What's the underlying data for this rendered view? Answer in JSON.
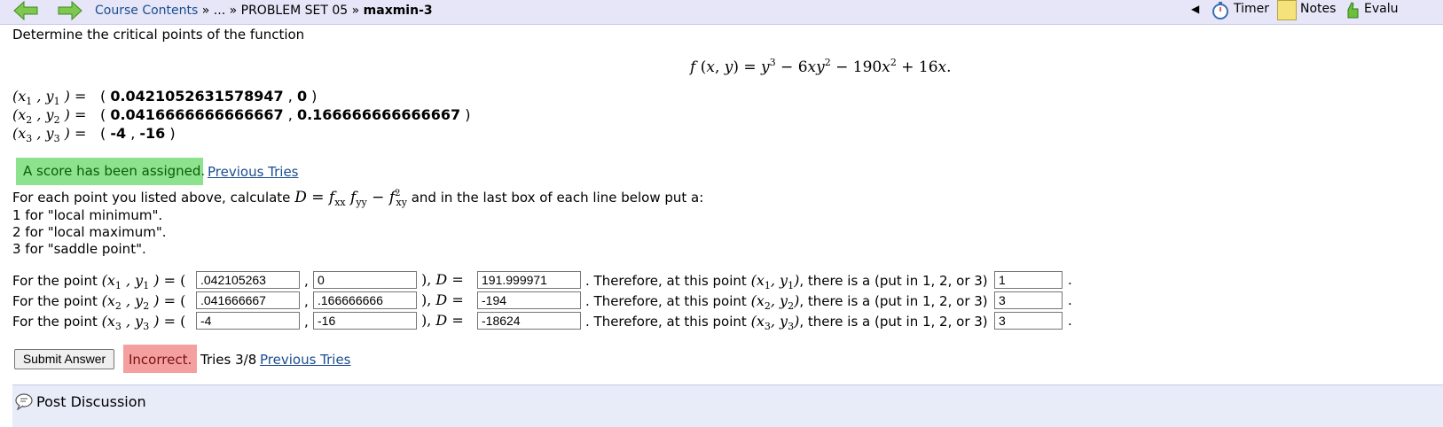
{
  "nav": {
    "crumb_course": "Course Contents",
    "crumb_sep1": "»",
    "crumb_ellipsis": "...",
    "crumb_sep2": "»",
    "crumb_set": "PROBLEM SET 05",
    "crumb_sep3": "»",
    "crumb_problem": "maxmin-3",
    "timer_label": "Timer",
    "notes_label": "Notes",
    "eval_label": "Evalu"
  },
  "problem": {
    "prompt": "Determine the critical points of the function",
    "equals": "=",
    "points": [
      {
        "x": "0.0421052631578947",
        "y": "0"
      },
      {
        "x": "0.0416666666666667",
        "y": "0.166666666666667"
      },
      {
        "x": "-4",
        "y": "-16"
      }
    ],
    "score_status": "A score has been assigned.",
    "previous_tries": "Previous Tries",
    "instr_before": "For each point you listed above, calculate",
    "instr_after": "and in the last box of each line below put a:",
    "opt1": "1 for \"local minimum\".",
    "opt2": "2 for \"local maximum\".",
    "opt3": "3 for \"saddle point\".",
    "row_prefix": "For the point",
    "row_mid": ". Therefore, at this point",
    "row_tail": ", there is a (put in 1, 2, or 3)",
    "rows": [
      {
        "x": ".042105263",
        "y": "0",
        "d": "191.999971",
        "type": "1"
      },
      {
        "x": ".041666667",
        "y": ".166666666",
        "d": "-194",
        "type": "3"
      },
      {
        "x": "-4",
        "y": "-16",
        "d": "-18624",
        "type": "3"
      }
    ]
  },
  "submit": {
    "button": "Submit Answer",
    "result": "Incorrect.",
    "tries": "Tries 3/8",
    "previous_tries": "Previous Tries"
  },
  "discussion": {
    "label": "Post Discussion"
  },
  "colors": {
    "correct_bg": "#8de38d",
    "incorrect_bg": "#f4a0a0",
    "nav_bg": "#e6e6f8"
  }
}
